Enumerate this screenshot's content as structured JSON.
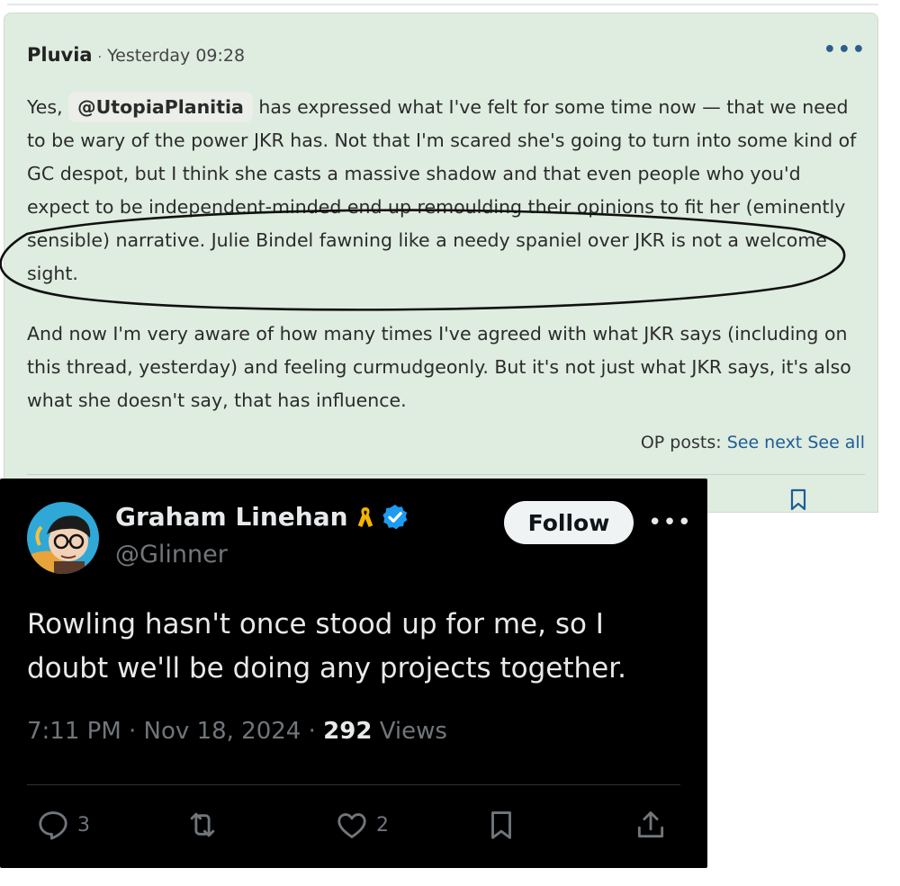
{
  "forum": {
    "author": "Pluvia",
    "separator": "·",
    "timestamp": "Yesterday 09:28",
    "more_icon": "more-horizontal-icon",
    "paragraph1_prefix": "Yes,",
    "mention": "@UtopiaPlanitia",
    "paragraph1_rest": "has expressed what I've felt for some time now — that we need to be wary of the power JKR has. Not that I'm scared she's going to turn into some kind of GC despot, but I think she casts a massive shadow and that even people who you'd expect to be independent-minded end up remoulding their opinions to fit her (eminently sensible) narrative. Julie Bindel fawning like a needy spaniel over JKR is not a welcome sight.",
    "paragraph2": "And now I'm very aware of how many times I've agreed with what JKR says (including on this thread, yesterday) and feeling curmudgeonly. But it's not just what JKR says, it's also what she doesn't say, that has influence.",
    "op_posts_label": "OP posts:",
    "see_next": "See next",
    "see_all": "See all",
    "background_color": "#dfece0",
    "link_color": "#1f5d96"
  },
  "tweet": {
    "display_name": "Graham Linehan",
    "handle": "@Glinner",
    "follow_label": "Follow",
    "text": "Rowling hasn't once stood up for me, so I doubt we'll be doing any projects together.",
    "time": "7:11 PM · Nov 18, 2024 ·",
    "views_count": "292",
    "views_label": "Views",
    "reply_count": "3",
    "like_count": "2",
    "ribbon_color": "#f4b400",
    "verified_color": "#1d9bf0"
  }
}
